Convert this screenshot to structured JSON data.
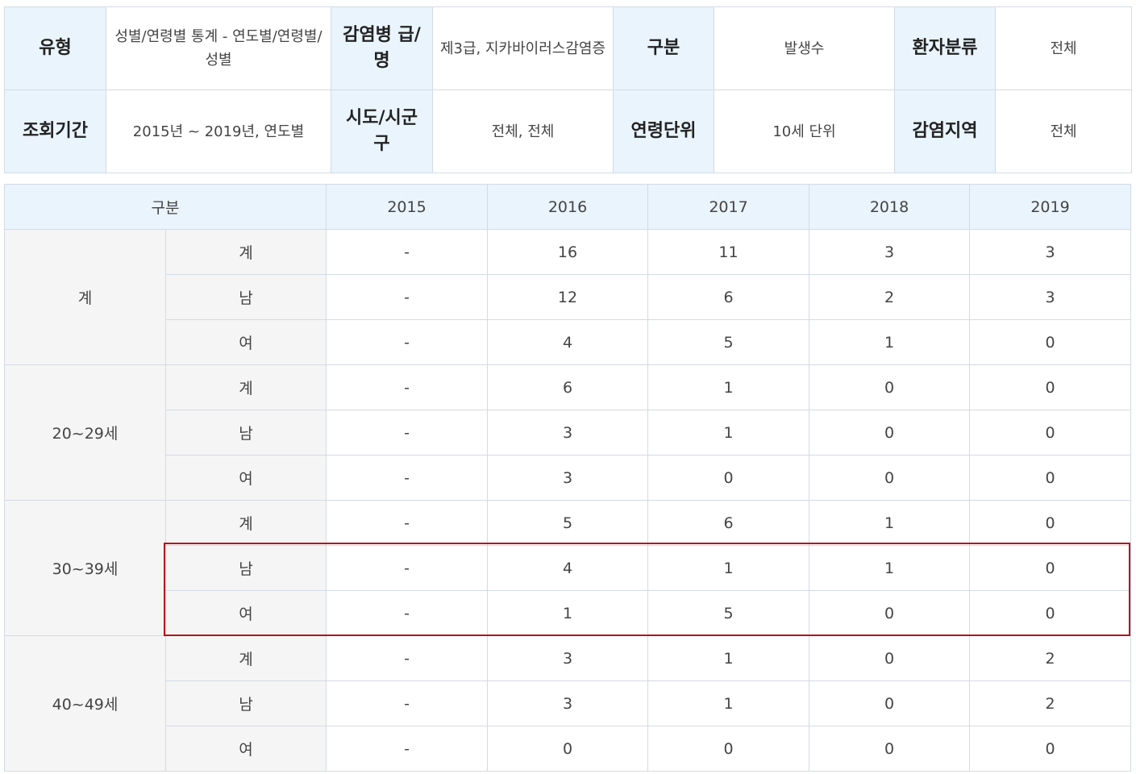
{
  "info": {
    "row1": [
      {
        "label": "유형",
        "value": "성별/연령별 통계 - 연도별/연령별/성별"
      },
      {
        "label": "감염병 급/명",
        "value": "제3급, 지카바이러스감염증"
      },
      {
        "label": "구분",
        "value": "발생수"
      },
      {
        "label": "환자분류",
        "value": "전체"
      }
    ],
    "row2": [
      {
        "label": "조회기간",
        "value": "2015년 ~ 2019년, 연도별"
      },
      {
        "label": "시도/시군구",
        "value": "전체, 전체"
      },
      {
        "label": "연령단위",
        "value": "10세 단위"
      },
      {
        "label": "감염지역",
        "value": "전체"
      }
    ]
  },
  "table": {
    "header": {
      "group_label": "구분",
      "years": [
        "2015",
        "2016",
        "2017",
        "2018",
        "2019"
      ]
    },
    "groups": [
      {
        "name": "계",
        "rows": [
          {
            "sex": "계",
            "values": [
              "-",
              "16",
              "11",
              "3",
              "3"
            ]
          },
          {
            "sex": "남",
            "values": [
              "-",
              "12",
              "6",
              "2",
              "3"
            ]
          },
          {
            "sex": "여",
            "values": [
              "-",
              "4",
              "5",
              "1",
              "0"
            ]
          }
        ]
      },
      {
        "name": "20~29세",
        "rows": [
          {
            "sex": "계",
            "values": [
              "-",
              "6",
              "1",
              "0",
              "0"
            ]
          },
          {
            "sex": "남",
            "values": [
              "-",
              "3",
              "1",
              "0",
              "0"
            ]
          },
          {
            "sex": "여",
            "values": [
              "-",
              "3",
              "0",
              "0",
              "0"
            ]
          }
        ]
      },
      {
        "name": "30~39세",
        "rows": [
          {
            "sex": "계",
            "values": [
              "-",
              "5",
              "6",
              "1",
              "0"
            ]
          },
          {
            "sex": "남",
            "values": [
              "-",
              "4",
              "1",
              "1",
              "0"
            ]
          },
          {
            "sex": "여",
            "values": [
              "-",
              "1",
              "5",
              "0",
              "0"
            ]
          }
        ]
      },
      {
        "name": "40~49세",
        "rows": [
          {
            "sex": "계",
            "values": [
              "-",
              "3",
              "1",
              "0",
              "2"
            ]
          },
          {
            "sex": "남",
            "values": [
              "-",
              "3",
              "1",
              "0",
              "2"
            ]
          },
          {
            "sex": "여",
            "values": [
              "-",
              "0",
              "0",
              "0",
              "0"
            ]
          }
        ]
      }
    ]
  },
  "colors": {
    "header_bg": "#eaf4fd",
    "label_bg": "#f5f5f5",
    "border": "#d3dbe5",
    "highlight": "#b3131c"
  }
}
